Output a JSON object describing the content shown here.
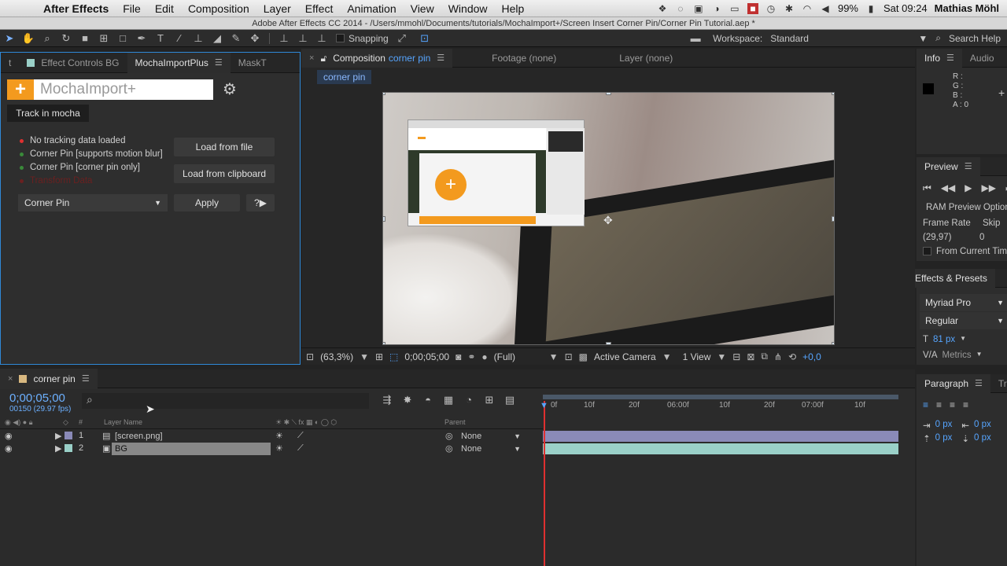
{
  "menubar": {
    "items": [
      "After Effects",
      "File",
      "Edit",
      "Composition",
      "Layer",
      "Effect",
      "Animation",
      "View",
      "Window",
      "Help"
    ],
    "battery": "99%",
    "clock": "Sat 09:24",
    "user": "Mathias Möhl"
  },
  "titlebar": {
    "title": "Adobe After Effects CC 2014 - /Users/mmohl/Documents/tutorials/MochaImport+/Screen Insert Corner Pin/Corner Pin Tutorial.aep *"
  },
  "toolbar": {
    "snapping": "Snapping",
    "workspace_label": "Workspace:",
    "workspace_value": "Standard",
    "search_help": "Search Help"
  },
  "left_panel": {
    "tabs": [
      "Effect Controls BG",
      "MochaImportPlus",
      "MaskT"
    ],
    "logo_text": "MochaImport+",
    "track_button": "Track in mocha",
    "status_items": [
      {
        "label": "No tracking data loaded",
        "color": "#e03030"
      },
      {
        "label": "Corner Pin [supports motion blur]",
        "color": "#3a8a3a"
      },
      {
        "label": "Corner Pin [corner pin only]",
        "color": "#3a8a3a"
      },
      {
        "label": "Transform Data",
        "color": "#6a2020"
      }
    ],
    "load_file": "Load from file",
    "load_clipboard": "Load from clipboard",
    "mode_select": "Corner Pin",
    "apply": "Apply",
    "help": "?▶"
  },
  "comp_panel": {
    "tab_label": "Composition",
    "comp_name": "corner pin",
    "footage_tab": "Footage (none)",
    "layer_tab": "Layer (none)",
    "breadcrumb": "corner pin",
    "footer": {
      "zoom": "(63,3%)",
      "timecode": "0;00;05;00",
      "resolution": "(Full)",
      "camera": "Active Camera",
      "views": "1 View",
      "exposure": "+0,0"
    }
  },
  "info_panel": {
    "tabs": [
      "Info",
      "Audio"
    ],
    "r": "R :",
    "g": "G :",
    "b": "B :",
    "a": "A : 0"
  },
  "preview_panel": {
    "tab": "Preview",
    "ram_preview": "RAM Preview Options",
    "frame_rate_label": "Frame Rate",
    "skip_label": "Skip",
    "frame_rate": "(29,97)",
    "skip": "0",
    "from_current": "From Current Time"
  },
  "effects_panel": {
    "tab": "Effects & Presets",
    "font": "Myriad Pro",
    "style": "Regular",
    "size": "81 px",
    "metrics": "Metrics"
  },
  "timeline": {
    "tab": "corner pin",
    "timecode": "0;00;05;00",
    "fps": "00150 (29.97 fps)",
    "col_layer_name": "Layer Name",
    "col_hash": "#",
    "col_parent": "Parent",
    "layers": [
      {
        "num": "1",
        "name": "[screen.png]",
        "parent": "None",
        "color": "#8a8ab8",
        "selected": false
      },
      {
        "num": "2",
        "name": "BG",
        "parent": "None",
        "color": "#9ad0c8",
        "selected": true
      }
    ],
    "ruler": [
      "0f",
      "10f",
      "20f",
      "06:00f",
      "10f",
      "20f",
      "07:00f",
      "10f"
    ]
  },
  "paragraph_panel": {
    "tabs": [
      "Paragraph",
      "Tra"
    ],
    "indent1": "0 px",
    "indent2": "0 px",
    "indent3": "0 px",
    "indent4": "0 px"
  },
  "colors": {
    "accent": "#56a5ff",
    "mocha_orange": "#f39a1e",
    "playhead": "#e03030"
  }
}
